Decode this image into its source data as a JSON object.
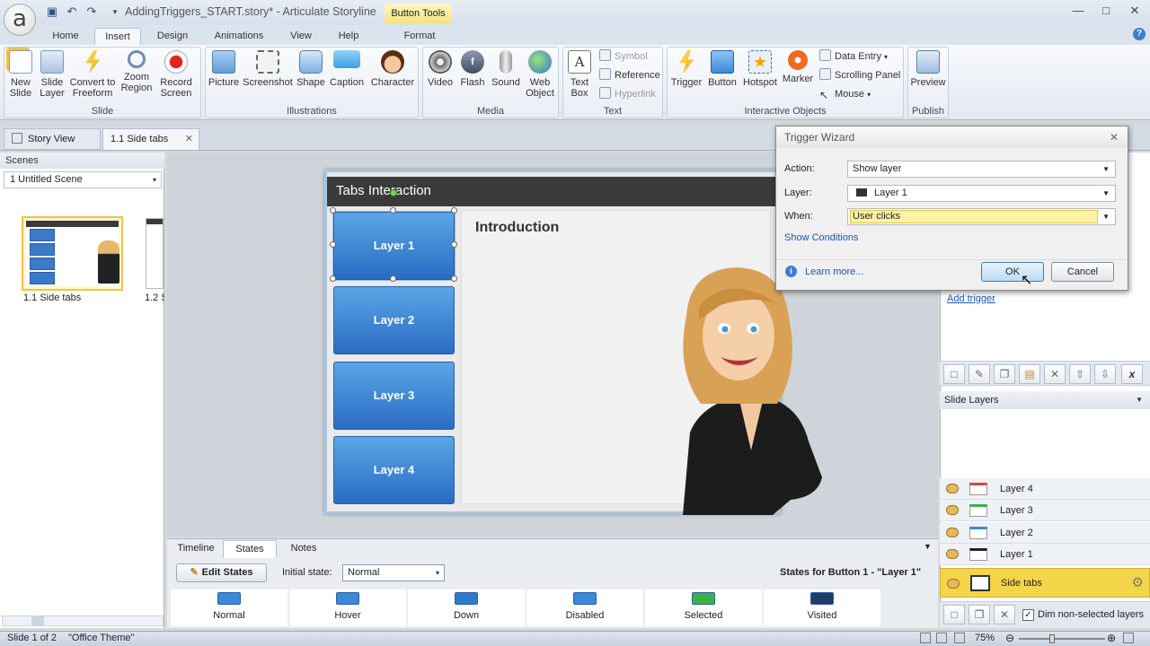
{
  "titlebar": {
    "doc_title": "AddingTriggers_START.story* - Articulate Storyline",
    "context_tab": "Button Tools",
    "logo": "a"
  },
  "ribbon_tabs": [
    "Home",
    "Insert",
    "Design",
    "Animations",
    "View",
    "Help",
    "Format"
  ],
  "groups": {
    "slide": {
      "label": "Slide",
      "buttons": [
        "New\nSlide",
        "Slide\nLayer",
        "Convert to\nFreeform",
        "Zoom\nRegion",
        "Record\nScreen"
      ]
    },
    "illustrations": {
      "label": "Illustrations",
      "buttons": [
        "Picture",
        "Screenshot",
        "Shape",
        "Caption",
        "Character"
      ]
    },
    "media": {
      "label": "Media",
      "buttons": [
        "Video",
        "Flash",
        "Sound",
        "Web\nObject"
      ]
    },
    "text": {
      "label": "Text",
      "textbox": "Text\nBox",
      "symbol": "Symbol",
      "reference": "Reference",
      "hyperlink": "Hyperlink"
    },
    "interactive": {
      "label": "Interactive Objects",
      "buttons": [
        "Trigger",
        "Button",
        "Hotspot",
        "Marker"
      ],
      "data_entry": "Data Entry",
      "scrolling_panel": "Scrolling Panel",
      "mouse": "Mouse"
    },
    "publish": {
      "label": "Publish",
      "preview": "Preview"
    }
  },
  "doc_tabs": {
    "story_view": "Story View",
    "slide_tab": "1.1 Side tabs"
  },
  "left_panel": {
    "header": "Scenes",
    "scene": "1 Untitled Scene",
    "thumb1_label": "1.1 Side tabs",
    "thumb2_label": "1.2 S"
  },
  "slide": {
    "title": "Tabs Interaction",
    "content_heading": "Introduction",
    "buttons": [
      "Layer 1",
      "Layer 2",
      "Layer 3",
      "Layer 4"
    ],
    "thumb_text": "Introduction"
  },
  "bottom": {
    "tabs": [
      "Timeline",
      "States",
      "Notes"
    ],
    "edit_states": "Edit States",
    "initial_state_label": "Initial state:",
    "initial_state_value": "Normal",
    "states_for": "States for Button 1 - \"Layer 1\"",
    "states": [
      {
        "name": "Normal",
        "color": "#3a8ad6"
      },
      {
        "name": "Hover",
        "color": "#3a8ad6"
      },
      {
        "name": "Down",
        "color": "#2e7cc8"
      },
      {
        "name": "Disabled",
        "color": "#3a8ad6"
      },
      {
        "name": "Selected",
        "color": "#3cb043"
      },
      {
        "name": "Visited",
        "color": "#1f3f66"
      }
    ]
  },
  "right_panel": {
    "add_trigger": "Add trigger",
    "slide_layers_header": "Slide Layers",
    "layers": [
      {
        "name": "Layer 4",
        "color": "#d24a3a"
      },
      {
        "name": "Layer 3",
        "color": "#3cb043"
      },
      {
        "name": "Layer 2",
        "color": "#3a8ad6"
      },
      {
        "name": "Layer 1",
        "color": "#222222"
      }
    ],
    "base_layer": "Side tabs",
    "dim_label": "Dim non-selected layers"
  },
  "wizard": {
    "title": "Trigger Wizard",
    "action_label": "Action:",
    "action_value": "Show layer",
    "layer_label": "Layer:",
    "layer_value": "Layer 1",
    "when_label": "When:",
    "when_value": "User clicks",
    "show_conditions": "Show Conditions",
    "learn_more": "Learn more...",
    "ok": "OK",
    "cancel": "Cancel"
  },
  "statusbar": {
    "slide": "Slide 1 of 2",
    "theme": "\"Office Theme\"",
    "zoom": "75%"
  },
  "colors": {
    "accent": "#2a6cc4",
    "base_layer_highlight": "#f4d54a"
  }
}
